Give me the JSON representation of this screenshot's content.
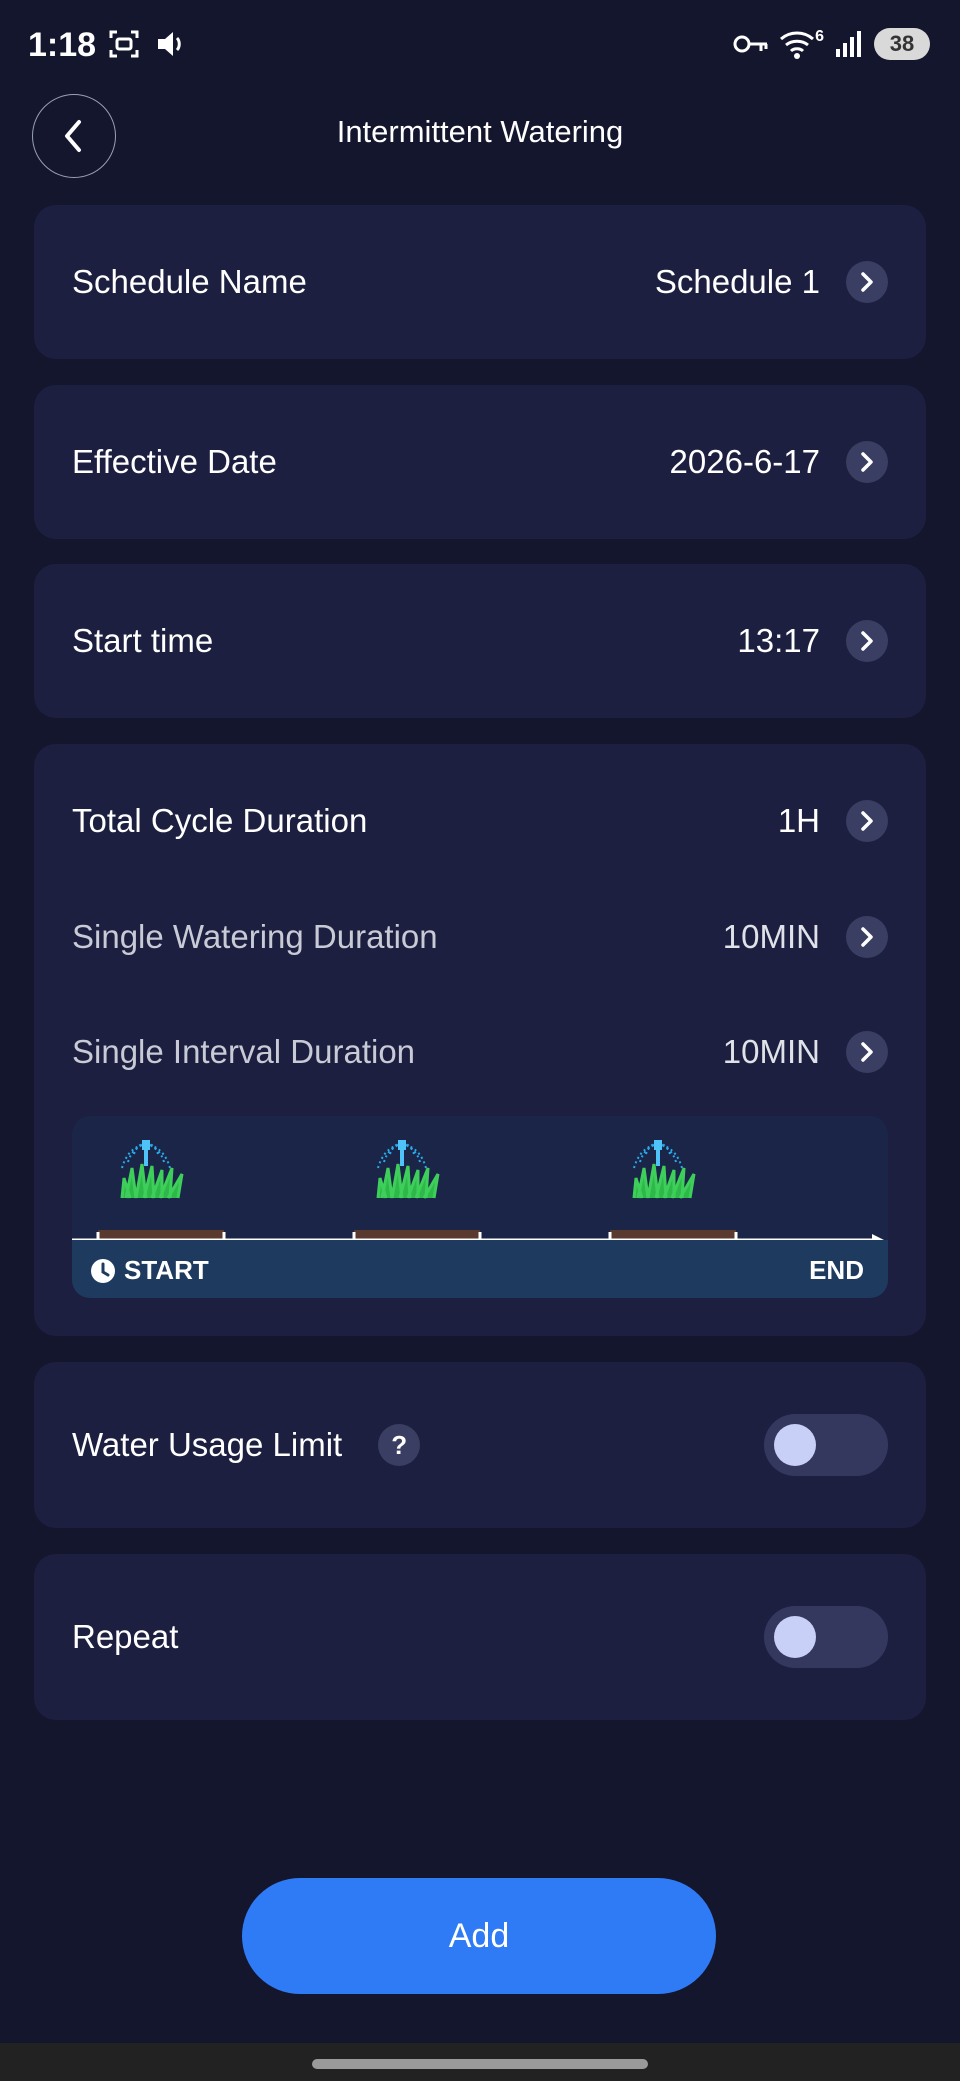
{
  "status_bar": {
    "time": "1:18",
    "wifi_badge": "6",
    "battery": "38",
    "icons": [
      "screenshot-icon",
      "audio-icon",
      "key-icon",
      "wifi-icon",
      "signal-icon"
    ]
  },
  "header": {
    "title": "Intermittent Watering",
    "back_icon": "chevron-left-icon"
  },
  "settings": {
    "schedule_name": {
      "label": "Schedule Name",
      "value": "Schedule 1"
    },
    "effective_date": {
      "label": "Effective Date",
      "value": "2026-6-17"
    },
    "start_time": {
      "label": "Start time",
      "value": "13:17"
    },
    "total_cycle": {
      "label": "Total Cycle Duration",
      "value": "1H"
    },
    "single_watering": {
      "label": "Single Watering Duration",
      "value": "10MIN"
    },
    "single_interval": {
      "label": "Single Interval Duration",
      "value": "10MIN"
    }
  },
  "diagram": {
    "start_label": "START",
    "end_label": "END"
  },
  "water_limit": {
    "label": "Water Usage Limit",
    "help": "?",
    "enabled": false
  },
  "repeat": {
    "label": "Repeat",
    "enabled": false
  },
  "actions": {
    "add_label": "Add"
  },
  "colors": {
    "background": "#14162e",
    "card": "#1c1f3f",
    "accent": "#2f7bf6"
  }
}
